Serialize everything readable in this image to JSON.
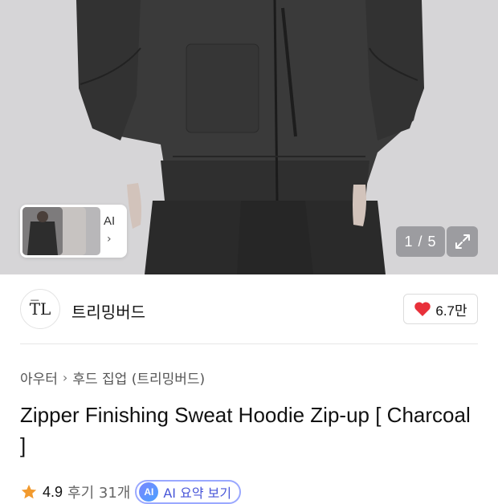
{
  "gallery": {
    "counter": "1 / 5",
    "ai_label": "AI",
    "expand_icon": "expand-icon"
  },
  "brand": {
    "logo_text": "T̅L",
    "name": "트리밍버드",
    "like_count": "6.7만"
  },
  "breadcrumb": {
    "category": "아우터",
    "subcategory": "후드 집업 (트리밍버드)"
  },
  "product": {
    "title": "Zipper Finishing Sweat Hoodie Zip-up [ Charcoal ]"
  },
  "rating": {
    "value": "4.9",
    "review_label": "후기 31개",
    "ai_summary_label": "AI 요약 보기",
    "ai_badge": "AI"
  },
  "colors": {
    "like_heart": "#e8303a",
    "star": "#f29a2e",
    "ai_accent": "#4856d8"
  }
}
